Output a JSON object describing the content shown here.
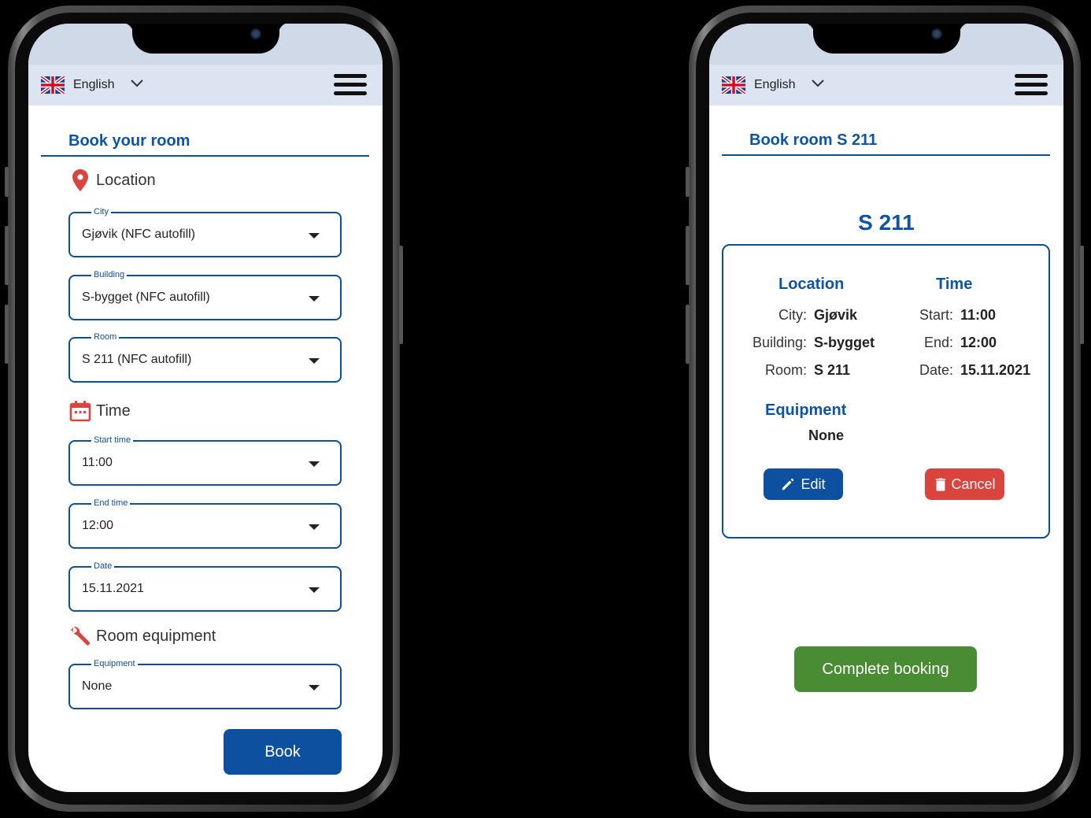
{
  "header": {
    "language": "English"
  },
  "booking_form": {
    "title": "Book your room",
    "location_heading": "Location",
    "time_heading": "Time",
    "equipment_heading": "Room equipment",
    "fields": {
      "city": {
        "label": "City",
        "value": "Gjøvik (NFC autofill)"
      },
      "building": {
        "label": "Building",
        "value": "S-bygget (NFC autofill)"
      },
      "room": {
        "label": "Room",
        "value": "S 211 (NFC autofill)"
      },
      "start_time": {
        "label": "Start time",
        "value": "11:00"
      },
      "end_time": {
        "label": "End time",
        "value": "12:00"
      },
      "date": {
        "label": "Date",
        "value": "15.11.2021"
      },
      "equipment": {
        "label": "Equipment",
        "value": "None"
      }
    },
    "book_label": "Book"
  },
  "summary": {
    "title": "Book room S 211",
    "room": "S 211",
    "location_heading": "Location",
    "time_heading": "Time",
    "city_key": "City:",
    "city_value": "Gjøvik",
    "building_key": "Building:",
    "building_value": "S-bygget",
    "room_key": "Room:",
    "room_value": "S 211",
    "start_key": "Start:",
    "start_value": "11:00",
    "end_key": "End:",
    "end_value": "12:00",
    "date_key": "Date:",
    "date_value": "15.11.2021",
    "equipment_heading": "Equipment",
    "equipment_value": "None",
    "edit_label": "Edit",
    "cancel_label": "Cancel",
    "complete_label": "Complete booking"
  },
  "colors": {
    "brand_blue": "#0d55a4",
    "danger_red": "#d9443f",
    "success_green": "#4a8c33",
    "header_bg": "#dbe4f0"
  },
  "icons": [
    "uk-flag-icon",
    "chevron-down-icon",
    "hamburger-menu-icon",
    "location-pin-icon",
    "calendar-icon",
    "wrench-icon",
    "pencil-icon",
    "trash-icon"
  ]
}
